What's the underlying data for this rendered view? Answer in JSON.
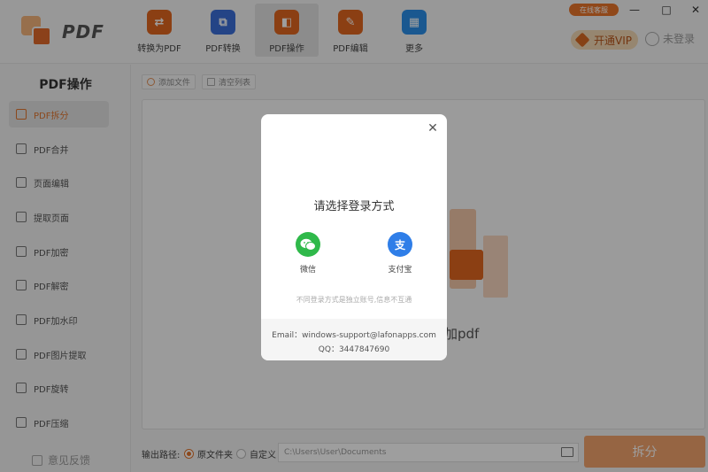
{
  "app": {
    "logo_text": "PDF"
  },
  "nav": {
    "items": [
      {
        "label": "转换为PDF",
        "icon": "convert-to-pdf-icon",
        "color": "#e0661f"
      },
      {
        "label": "PDF转换",
        "icon": "pdf-convert-icon",
        "color": "#3a6fd8"
      },
      {
        "label": "PDF操作",
        "icon": "pdf-operate-icon",
        "color": "#e0661f"
      },
      {
        "label": "PDF编辑",
        "icon": "pdf-edit-icon",
        "color": "#e0661f"
      },
      {
        "label": "更多",
        "icon": "more-icon",
        "color": "#2b8fe8"
      }
    ]
  },
  "header": {
    "support_label": "在线客服",
    "vip_label": "开通VIP",
    "login_label": "未登录"
  },
  "window_controls": {
    "minimize": "—",
    "maximize": "□",
    "close": "✕"
  },
  "sidebar": {
    "title": "PDF操作",
    "items": [
      {
        "label": "PDF拆分",
        "active": true
      },
      {
        "label": "PDF合并"
      },
      {
        "label": "页面编辑"
      },
      {
        "label": "提取页面"
      },
      {
        "label": "PDF加密"
      },
      {
        "label": "PDF解密"
      },
      {
        "label": "PDF加水印"
      },
      {
        "label": "PDF图片提取"
      },
      {
        "label": "PDF旋转"
      },
      {
        "label": "PDF压缩"
      }
    ],
    "feedback_label": "意见反馈"
  },
  "toolbar": {
    "add_file": "添加文件",
    "clear_list": "清空列表"
  },
  "dropzone": {
    "hint_visible": "加pdf"
  },
  "output": {
    "label": "输出路径:",
    "option_original": "原文件夹",
    "option_custom": "自定义",
    "path_value": "C:\\Users\\User\\Documents",
    "split_button": "拆分"
  },
  "modal": {
    "close_glyph": "✕",
    "title": "请选择登录方式",
    "wechat": {
      "label": "微信",
      "color": "#2fb94a"
    },
    "alipay": {
      "label": "支付宝",
      "glyph": "支",
      "color": "#2f7ee8"
    },
    "notice": "不同登录方式是独立账号,信息不互通",
    "email": "Email：windows-support@lafonapps.com",
    "qq": "QQ：3447847690"
  }
}
